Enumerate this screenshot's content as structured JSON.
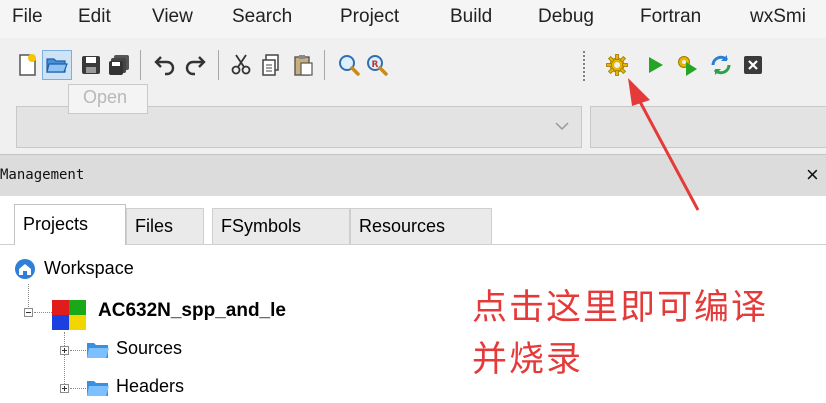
{
  "menu": [
    "File",
    "Edit",
    "View",
    "Search",
    "Project",
    "Build",
    "Debug",
    "Fortran",
    "wxSmi"
  ],
  "toolbar": {
    "tooltip": "Open",
    "buttons": [
      "new-file",
      "open",
      "save",
      "save-all",
      "undo",
      "redo",
      "cut",
      "copy",
      "paste",
      "find",
      "replace",
      "build",
      "run",
      "build-and-run",
      "rebuild",
      "abort"
    ]
  },
  "management": {
    "title": "Management",
    "close": "×",
    "tabs": [
      "Projects",
      "Files",
      "FSymbols",
      "Resources"
    ],
    "active_tab": "Projects"
  },
  "tree": {
    "workspace": "Workspace",
    "project": "AC632N_spp_and_le",
    "folders": [
      "Sources",
      "Headers"
    ]
  },
  "annotation": "点击这里即可编译并烧录",
  "colors": {
    "annotation": "#e53a3a",
    "arrow": "#e53a3a"
  }
}
